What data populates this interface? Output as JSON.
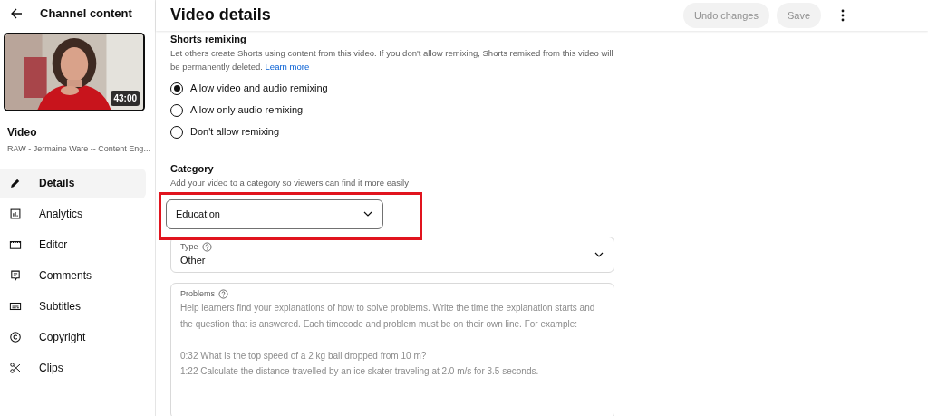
{
  "sidebar": {
    "back_label": "Channel content",
    "video": {
      "duration": "43:00",
      "label": "Video",
      "title": "RAW - Jermaine Ware -- Content Eng..."
    },
    "items": [
      {
        "label": "Details",
        "selected": true
      },
      {
        "label": "Analytics",
        "selected": false
      },
      {
        "label": "Editor",
        "selected": false
      },
      {
        "label": "Comments",
        "selected": false
      },
      {
        "label": "Subtitles",
        "selected": false
      },
      {
        "label": "Copyright",
        "selected": false
      },
      {
        "label": "Clips",
        "selected": false
      }
    ]
  },
  "header": {
    "title": "Video details",
    "buttons": [
      {
        "label": "Undo changes",
        "disabled": true
      },
      {
        "label": "Save",
        "disabled": true
      }
    ]
  },
  "remixing": {
    "heading": "Shorts remixing",
    "description": "Let others create Shorts using content from this video. If you don't allow remixing, Shorts remixed from this video will be permanently deleted.",
    "link": "Learn more",
    "options": [
      {
        "label": "Allow video and audio remixing",
        "selected": true
      },
      {
        "label": "Allow only audio remixing",
        "selected": false
      },
      {
        "label": "Don't allow remixing",
        "selected": false
      }
    ]
  },
  "category": {
    "heading": "Category",
    "description": "Add your video to a category so viewers can find it more easily",
    "value": "Education",
    "highlighted": true
  },
  "type_field": {
    "label": "Type",
    "value": "Other"
  },
  "problems_field": {
    "label": "Problems",
    "placeholder": "Help learners find your explanations of how to solve problems. Write the time the explanation starts and the question that is answered. Each timecode and problem must be on their own line. For example:\n\n0:32 What is the top speed of a 2 kg ball dropped from 10 m?\n1:22 Calculate the distance travelled by an ice skater traveling at 2.0 m/s for 3.5 seconds."
  }
}
